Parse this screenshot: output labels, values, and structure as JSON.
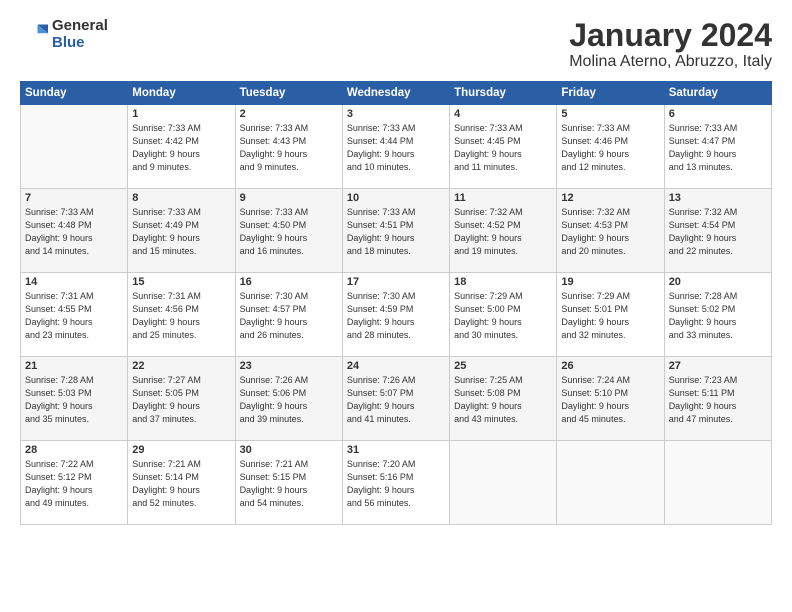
{
  "logo": {
    "general": "General",
    "blue": "Blue"
  },
  "header": {
    "month": "January 2024",
    "location": "Molina Aterno, Abruzzo, Italy"
  },
  "days_of_week": [
    "Sunday",
    "Monday",
    "Tuesday",
    "Wednesday",
    "Thursday",
    "Friday",
    "Saturday"
  ],
  "weeks": [
    [
      {
        "day": "",
        "info": ""
      },
      {
        "day": "1",
        "info": "Sunrise: 7:33 AM\nSunset: 4:42 PM\nDaylight: 9 hours\nand 9 minutes."
      },
      {
        "day": "2",
        "info": "Sunrise: 7:33 AM\nSunset: 4:43 PM\nDaylight: 9 hours\nand 9 minutes."
      },
      {
        "day": "3",
        "info": "Sunrise: 7:33 AM\nSunset: 4:44 PM\nDaylight: 9 hours\nand 10 minutes."
      },
      {
        "day": "4",
        "info": "Sunrise: 7:33 AM\nSunset: 4:45 PM\nDaylight: 9 hours\nand 11 minutes."
      },
      {
        "day": "5",
        "info": "Sunrise: 7:33 AM\nSunset: 4:46 PM\nDaylight: 9 hours\nand 12 minutes."
      },
      {
        "day": "6",
        "info": "Sunrise: 7:33 AM\nSunset: 4:47 PM\nDaylight: 9 hours\nand 13 minutes."
      }
    ],
    [
      {
        "day": "7",
        "info": "Sunrise: 7:33 AM\nSunset: 4:48 PM\nDaylight: 9 hours\nand 14 minutes."
      },
      {
        "day": "8",
        "info": "Sunrise: 7:33 AM\nSunset: 4:49 PM\nDaylight: 9 hours\nand 15 minutes."
      },
      {
        "day": "9",
        "info": "Sunrise: 7:33 AM\nSunset: 4:50 PM\nDaylight: 9 hours\nand 16 minutes."
      },
      {
        "day": "10",
        "info": "Sunrise: 7:33 AM\nSunset: 4:51 PM\nDaylight: 9 hours\nand 18 minutes."
      },
      {
        "day": "11",
        "info": "Sunrise: 7:32 AM\nSunset: 4:52 PM\nDaylight: 9 hours\nand 19 minutes."
      },
      {
        "day": "12",
        "info": "Sunrise: 7:32 AM\nSunset: 4:53 PM\nDaylight: 9 hours\nand 20 minutes."
      },
      {
        "day": "13",
        "info": "Sunrise: 7:32 AM\nSunset: 4:54 PM\nDaylight: 9 hours\nand 22 minutes."
      }
    ],
    [
      {
        "day": "14",
        "info": "Sunrise: 7:31 AM\nSunset: 4:55 PM\nDaylight: 9 hours\nand 23 minutes."
      },
      {
        "day": "15",
        "info": "Sunrise: 7:31 AM\nSunset: 4:56 PM\nDaylight: 9 hours\nand 25 minutes."
      },
      {
        "day": "16",
        "info": "Sunrise: 7:30 AM\nSunset: 4:57 PM\nDaylight: 9 hours\nand 26 minutes."
      },
      {
        "day": "17",
        "info": "Sunrise: 7:30 AM\nSunset: 4:59 PM\nDaylight: 9 hours\nand 28 minutes."
      },
      {
        "day": "18",
        "info": "Sunrise: 7:29 AM\nSunset: 5:00 PM\nDaylight: 9 hours\nand 30 minutes."
      },
      {
        "day": "19",
        "info": "Sunrise: 7:29 AM\nSunset: 5:01 PM\nDaylight: 9 hours\nand 32 minutes."
      },
      {
        "day": "20",
        "info": "Sunrise: 7:28 AM\nSunset: 5:02 PM\nDaylight: 9 hours\nand 33 minutes."
      }
    ],
    [
      {
        "day": "21",
        "info": "Sunrise: 7:28 AM\nSunset: 5:03 PM\nDaylight: 9 hours\nand 35 minutes."
      },
      {
        "day": "22",
        "info": "Sunrise: 7:27 AM\nSunset: 5:05 PM\nDaylight: 9 hours\nand 37 minutes."
      },
      {
        "day": "23",
        "info": "Sunrise: 7:26 AM\nSunset: 5:06 PM\nDaylight: 9 hours\nand 39 minutes."
      },
      {
        "day": "24",
        "info": "Sunrise: 7:26 AM\nSunset: 5:07 PM\nDaylight: 9 hours\nand 41 minutes."
      },
      {
        "day": "25",
        "info": "Sunrise: 7:25 AM\nSunset: 5:08 PM\nDaylight: 9 hours\nand 43 minutes."
      },
      {
        "day": "26",
        "info": "Sunrise: 7:24 AM\nSunset: 5:10 PM\nDaylight: 9 hours\nand 45 minutes."
      },
      {
        "day": "27",
        "info": "Sunrise: 7:23 AM\nSunset: 5:11 PM\nDaylight: 9 hours\nand 47 minutes."
      }
    ],
    [
      {
        "day": "28",
        "info": "Sunrise: 7:22 AM\nSunset: 5:12 PM\nDaylight: 9 hours\nand 49 minutes."
      },
      {
        "day": "29",
        "info": "Sunrise: 7:21 AM\nSunset: 5:14 PM\nDaylight: 9 hours\nand 52 minutes."
      },
      {
        "day": "30",
        "info": "Sunrise: 7:21 AM\nSunset: 5:15 PM\nDaylight: 9 hours\nand 54 minutes."
      },
      {
        "day": "31",
        "info": "Sunrise: 7:20 AM\nSunset: 5:16 PM\nDaylight: 9 hours\nand 56 minutes."
      },
      {
        "day": "",
        "info": ""
      },
      {
        "day": "",
        "info": ""
      },
      {
        "day": "",
        "info": ""
      }
    ]
  ]
}
